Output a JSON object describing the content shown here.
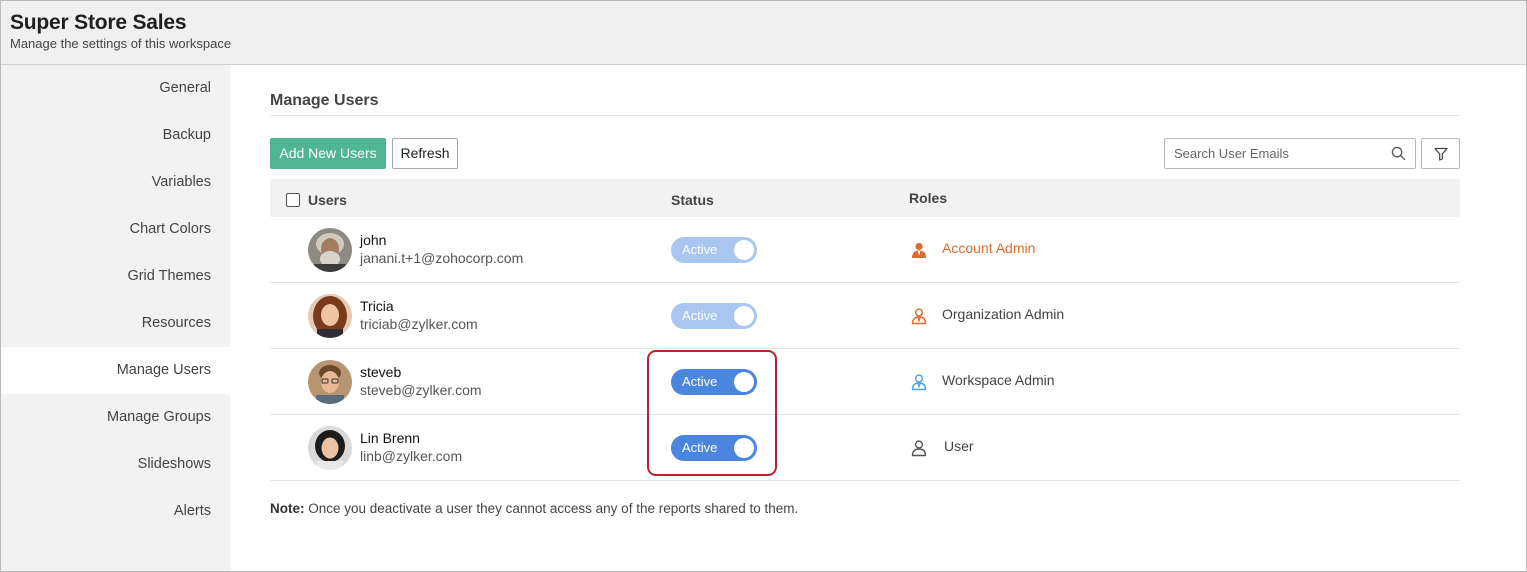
{
  "header": {
    "title": "Super Store Sales",
    "subtitle": "Manage the settings of this workspace"
  },
  "sidebar": {
    "items": [
      {
        "label": "General"
      },
      {
        "label": "Backup"
      },
      {
        "label": "Variables"
      },
      {
        "label": "Chart Colors"
      },
      {
        "label": "Grid Themes"
      },
      {
        "label": "Resources"
      },
      {
        "label": "Manage Users",
        "active": true
      },
      {
        "label": "Manage Groups"
      },
      {
        "label": "Slideshows"
      },
      {
        "label": "Alerts"
      }
    ]
  },
  "main": {
    "section_title": "Manage Users",
    "add_button": "Add New Users",
    "refresh_button": "Refresh",
    "search": {
      "placeholder": "Search User Emails",
      "value": ""
    },
    "columns": {
      "users": "Users",
      "status": "Status",
      "roles": "Roles"
    },
    "users": [
      {
        "name": "john",
        "email": "janani.t+1@zohocorp.com",
        "status": "Active",
        "status_enabled": false,
        "role": "Account Admin",
        "role_color": "#e06a2a"
      },
      {
        "name": "Tricia",
        "email": "triciab@zylker.com",
        "status": "Active",
        "status_enabled": false,
        "role": "Organization Admin",
        "role_color": "#e06a2a"
      },
      {
        "name": "steveb",
        "email": "steveb@zylker.com",
        "status": "Active",
        "status_enabled": true,
        "role": "Workspace Admin",
        "role_color": "#4aa3df"
      },
      {
        "name": "Lin Brenn",
        "email": "linb@zylker.com",
        "status": "Active",
        "status_enabled": true,
        "role": "User",
        "role_color": "#555555"
      }
    ],
    "note_label": "Note:",
    "note_text": " Once you deactivate a user they cannot access any of the reports shared to them."
  },
  "colors": {
    "primary_button": "#4fb592",
    "toggle_on": "#4a86e0",
    "toggle_disabled": "#a9c6f0",
    "admin_role": "#e06a2a",
    "highlight": "#b6262e"
  }
}
